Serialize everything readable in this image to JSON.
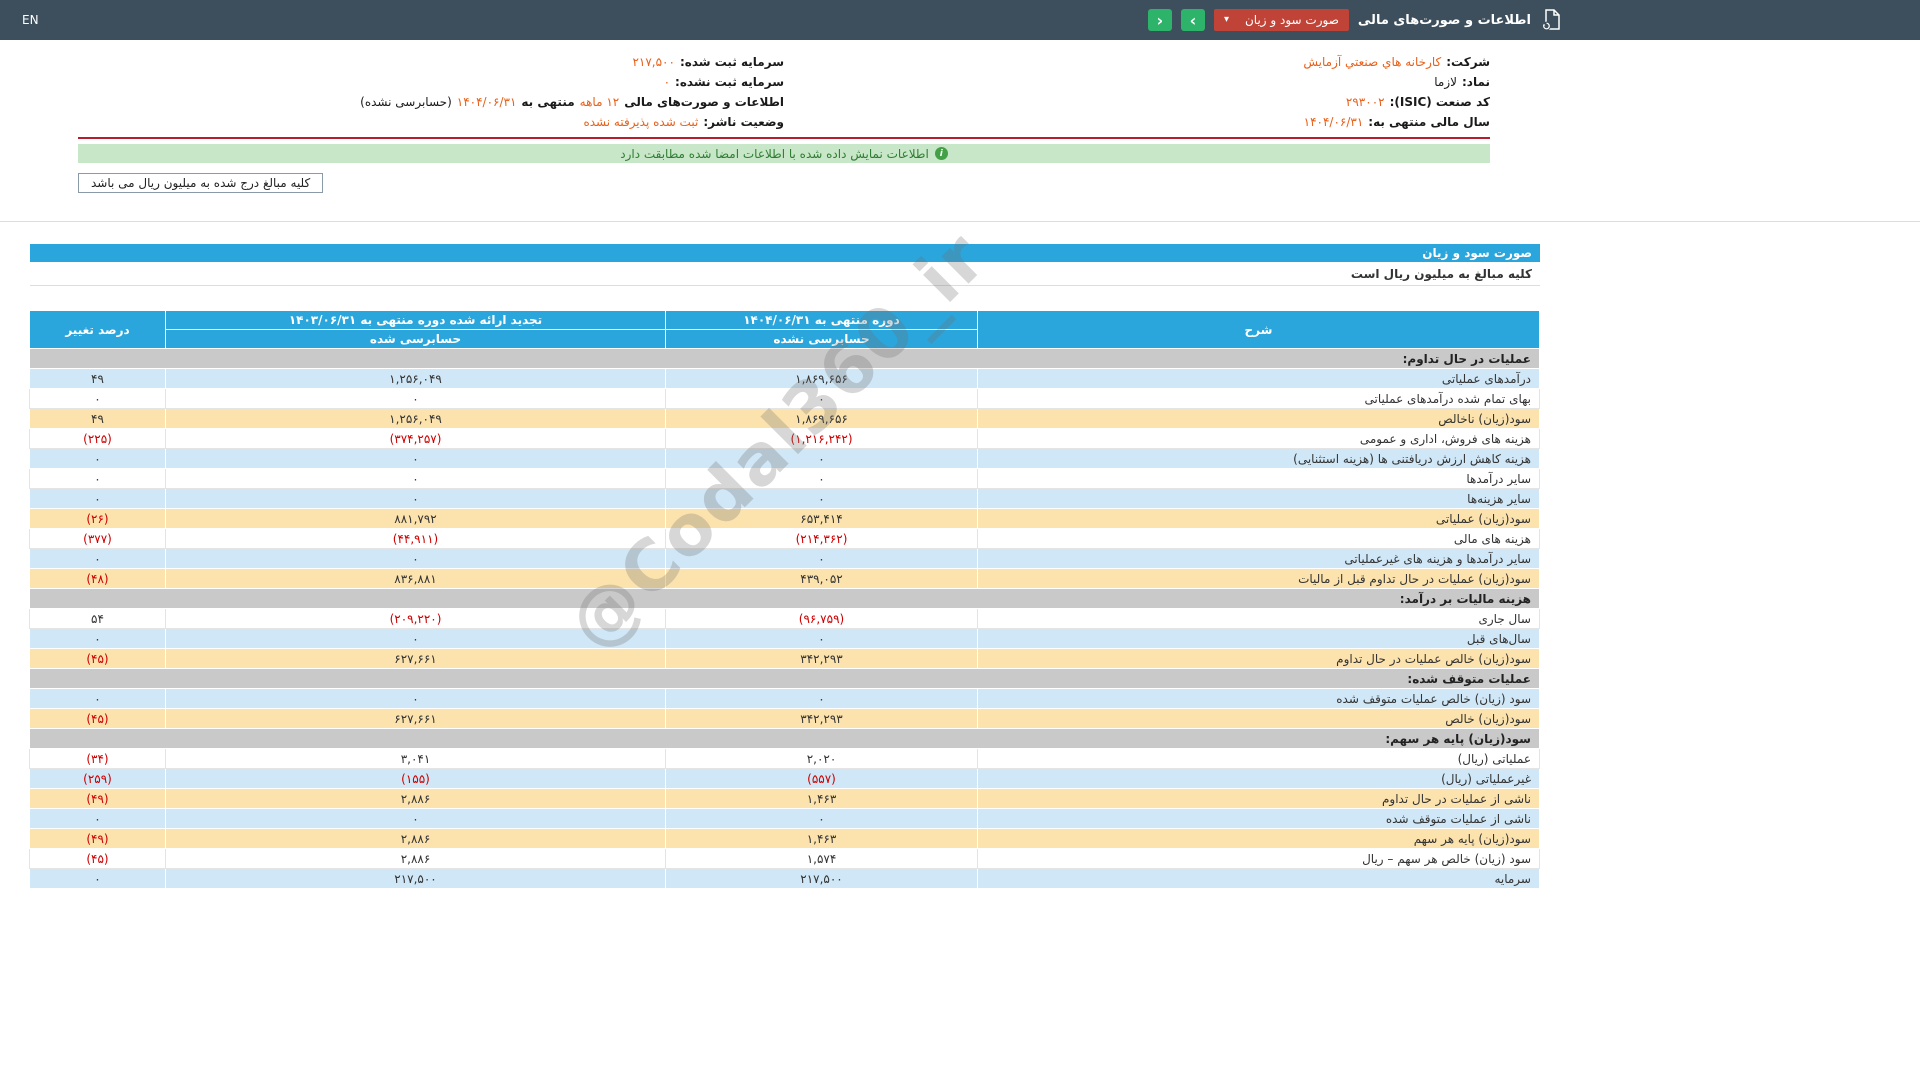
{
  "topbar": {
    "lang": "EN",
    "title": "اطلاعات و صورت‌های مالی",
    "report_dropdown": "صورت سود و زیان"
  },
  "icons": {
    "prev_chevron": "‹",
    "next_chevron": "›",
    "caret_down": "▾",
    "info": "i"
  },
  "company": {
    "right_rows": [
      {
        "label": "شرکت:",
        "value": "کارخانه هاي صنعتي آزمايش"
      },
      {
        "label": "نماد:",
        "value": "لازما"
      },
      {
        "label": "کد صنعت (ISIC):",
        "value": "۲۹۳۰۰۲"
      },
      {
        "label": "سال مالی منتهی به:",
        "value": "۱۴۰۴/۰۶/۳۱"
      }
    ],
    "left_rows": [
      {
        "label": "سرمایه ثبت شده:",
        "value": "۲۱۷,۵۰۰"
      },
      {
        "label": "سرمایه ثبت نشده:",
        "value": "۰"
      },
      {
        "label": "وضعیت ناشر:",
        "value": "ثبت شده پذیرفته نشده"
      }
    ],
    "period": {
      "prefix": "اطلاعات و صورت‌های مالی",
      "months": "۱۲ ماهه",
      "middle": "منتهی به",
      "date": "۱۴۰۴/۰۶/۳۱",
      "suffix": "(حسابرسی نشده)"
    }
  },
  "notice": {
    "text": "اطلاعات نمایش داده شده با اطلاعات امضا شده مطابقت دارد"
  },
  "amounts_note": "کلیه مبالغ درج شده به میلیون ریال می باشد",
  "report": {
    "title": "صورت سود و زیان",
    "subtitle": "کلیه مبالغ به میلیون ریال است"
  },
  "table": {
    "headers": {
      "desc": "شرح",
      "current_period": "دوره منتهی به ۱۴۰۴/۰۶/۳۱",
      "current_sub": "حسابرسی نشده",
      "prior_period": "تجدید ارائه شده دوره منتهی به ۱۴۰۳/۰۶/۳۱",
      "prior_sub": "حسابرسی شده",
      "change": "درصد تغییر"
    },
    "rows": [
      {
        "type": "section",
        "label": "عملیات در حال تداوم:"
      },
      {
        "type": "data",
        "style": "blue",
        "label": "درآمدهای عملیاتی",
        "current": "۱,۸۶۹,۶۵۶",
        "prior": "۱,۲۵۶,۰۴۹",
        "change": "۴۹"
      },
      {
        "type": "data",
        "style": "white",
        "label": "بهای تمام شده درآمدهای عملیاتی",
        "current": "۰",
        "prior": "۰",
        "change": "۰"
      },
      {
        "type": "data",
        "style": "yellow",
        "label": "سود(زیان) ناخالص",
        "current": "۱,۸۶۹,۶۵۶",
        "prior": "۱,۲۵۶,۰۴۹",
        "change": "۴۹"
      },
      {
        "type": "data",
        "style": "white",
        "label": "هزینه های فروش، اداری و عمومی",
        "current": "(۱,۲۱۶,۲۴۲)",
        "prior": "(۳۷۴,۲۵۷)",
        "change": "(۲۲۵)"
      },
      {
        "type": "data",
        "style": "blue",
        "label": "هزینه کاهش ارزش دریافتنی ها (هزینه استثنایی)",
        "current": "۰",
        "prior": "۰",
        "change": "۰"
      },
      {
        "type": "data",
        "style": "white",
        "label": "سایر درآمدها",
        "current": "۰",
        "prior": "۰",
        "change": "۰"
      },
      {
        "type": "data",
        "style": "blue",
        "label": "سایر هزینه‌ها",
        "current": "۰",
        "prior": "۰",
        "change": "۰"
      },
      {
        "type": "data",
        "style": "yellow",
        "label": "سود(زیان) عملیاتی",
        "current": "۶۵۳,۴۱۴",
        "prior": "۸۸۱,۷۹۲",
        "change": "(۲۶)"
      },
      {
        "type": "data",
        "style": "white",
        "label": "هزینه های مالی",
        "current": "(۲۱۴,۳۶۲)",
        "prior": "(۴۴,۹۱۱)",
        "change": "(۳۷۷)"
      },
      {
        "type": "data",
        "style": "blue",
        "label": "سایر درآمدها و هزینه های غیرعملیاتی",
        "current": "۰",
        "prior": "۰",
        "change": "۰"
      },
      {
        "type": "data",
        "style": "yellow",
        "label": "سود(زیان) عملیات در حال تداوم قبل از مالیات",
        "current": "۴۳۹,۰۵۲",
        "prior": "۸۳۶,۸۸۱",
        "change": "(۴۸)"
      },
      {
        "type": "section",
        "label": "هزینه مالیات بر درآمد:"
      },
      {
        "type": "data",
        "style": "white",
        "label": "سال جاری",
        "current": "(۹۶,۷۵۹)",
        "prior": "(۲۰۹,۲۲۰)",
        "change": "۵۴"
      },
      {
        "type": "data",
        "style": "blue",
        "label": "سال‌های قبل",
        "current": "۰",
        "prior": "۰",
        "change": "۰"
      },
      {
        "type": "data",
        "style": "yellow",
        "label": "سود(زیان) خالص عملیات در حال تداوم",
        "current": "۳۴۲,۲۹۳",
        "prior": "۶۲۷,۶۶۱",
        "change": "(۴۵)"
      },
      {
        "type": "section",
        "label": "عملیات متوقف شده:"
      },
      {
        "type": "data",
        "style": "blue",
        "label": "سود (زیان) خالص عملیات متوقف شده",
        "current": "۰",
        "prior": "۰",
        "change": "۰"
      },
      {
        "type": "data",
        "style": "yellow",
        "label": "سود(زیان) خالص",
        "current": "۳۴۲,۲۹۳",
        "prior": "۶۲۷,۶۶۱",
        "change": "(۴۵)"
      },
      {
        "type": "section",
        "label": "سود(زیان) پایه هر سهم:"
      },
      {
        "type": "data",
        "style": "white",
        "label": "عملیاتی (ریال)",
        "current": "۲,۰۲۰",
        "prior": "۳,۰۴۱",
        "change": "(۳۴)"
      },
      {
        "type": "data",
        "style": "blue",
        "label": "غیرعملیاتی (ریال)",
        "current": "(۵۵۷)",
        "prior": "(۱۵۵)",
        "change": "(۲۵۹)"
      },
      {
        "type": "data",
        "style": "yellow",
        "label": "ناشی از عملیات در حال تداوم",
        "current": "۱,۴۶۳",
        "prior": "۲,۸۸۶",
        "change": "(۴۹)"
      },
      {
        "type": "data",
        "style": "blue",
        "label": "ناشی از عملیات متوقف شده",
        "current": "۰",
        "prior": "۰",
        "change": "۰"
      },
      {
        "type": "data",
        "style": "yellow",
        "label": "سود(زیان) پایه هر سهم",
        "current": "۱,۴۶۳",
        "prior": "۲,۸۸۶",
        "change": "(۴۹)"
      },
      {
        "type": "data",
        "style": "white",
        "label": "سود (زیان) خالص هر سهم – ریال",
        "current": "۱,۵۷۴",
        "prior": "۲,۸۸۶",
        "change": "(۴۵)"
      },
      {
        "type": "data",
        "style": "blue",
        "label": "سرمایه",
        "current": "۲۱۷,۵۰۰",
        "prior": "۲۱۷,۵۰۰",
        "change": "۰"
      }
    ]
  },
  "watermark": "@Codal360_ir"
}
